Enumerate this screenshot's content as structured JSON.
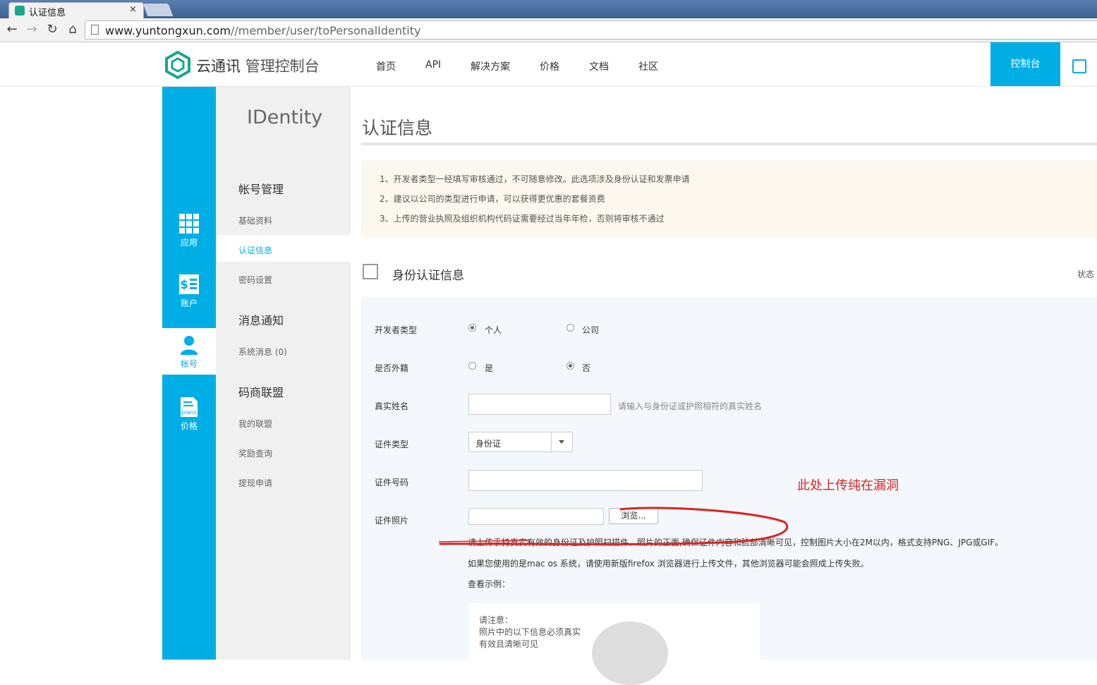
{
  "browser": {
    "tab_title": "认证信息",
    "tab_close": "×",
    "url_host": "www.yuntongxun.com",
    "url_path": "//member/user/toPersonalIdentity",
    "back_icon": "back-arrow-icon",
    "forward_icon": "forward-arrow-icon",
    "reload_icon": "reload-icon",
    "home_icon": "home-icon"
  },
  "header": {
    "brand": "云通讯",
    "brand_suffix": "管理控制台",
    "nav": [
      "首页",
      "API",
      "解决方案",
      "价格",
      "文档",
      "社区"
    ],
    "console_label": "控制台",
    "accent": "#00aee6"
  },
  "rail": {
    "items": [
      {
        "label": "应用",
        "icon": "apps-grid-icon"
      },
      {
        "label": "账户",
        "icon": "account-bill-icon"
      },
      {
        "label": "帐号",
        "icon": "user-icon"
      },
      {
        "label": "价格",
        "icon": "plans-doc-icon",
        "icon_text": "plans"
      }
    ]
  },
  "subnav": {
    "title": "IDentity",
    "groups": [
      {
        "heading": "帐号管理",
        "links": [
          "基础资料",
          "认证信息",
          "密码设置"
        ]
      },
      {
        "heading": "消息通知",
        "links": [
          "系统消息 (0)"
        ]
      },
      {
        "heading": "码商联盟",
        "links": [
          "我的联盟",
          "奖励查询",
          "提现申请"
        ]
      }
    ]
  },
  "main": {
    "page_title": "认证信息",
    "notices": [
      "1、开发者类型一经填写审核通过，不可随意修改。此选项涉及身份认证和发票申请",
      "2、建议以公司的类型进行申请，可以获得更优惠的套餐资费",
      "3、上传的营业执照及组织机构代码证需要经过当年年检，否则将审核不通过"
    ],
    "section_title": "身份认证信息",
    "status_label": "状态",
    "form": {
      "developer_type_label": "开发者类型",
      "developer_type_options": [
        "个人",
        "公司"
      ],
      "developer_type_selected": "个人",
      "foreign_label": "是否外籍",
      "foreign_options": [
        "是",
        "否"
      ],
      "foreign_selected": "否",
      "real_name_label": "真实姓名",
      "real_name_value": "",
      "real_name_hint": "请输入与身份证或护照相符的真实姓名",
      "id_type_label": "证件类型",
      "id_type_value": "身份证",
      "id_number_label": "证件号码",
      "id_number_value": "",
      "id_photo_label": "证件照片",
      "browse_label": "浏览...",
      "upload_note": "请上传手持真实有效的身份证及护照扫描件、照片的正面,确保证件内容和脸部清晰可见，控制图片大小在2M以内，格式支持PNG、JPG或GIF。",
      "mac_note": "如果您使用的是mac os 系统，请使用新版firefox 浏览器进行上传文件，其他浏览器可能会照成上传失败。",
      "example_label": "查看示例：",
      "example_card": [
        "请注意：",
        "照片中的以下信息必须真实",
        "有效且清晰可见"
      ]
    }
  },
  "annotation": {
    "text": "此处上传纯在漏洞",
    "color": "#dd2222"
  }
}
